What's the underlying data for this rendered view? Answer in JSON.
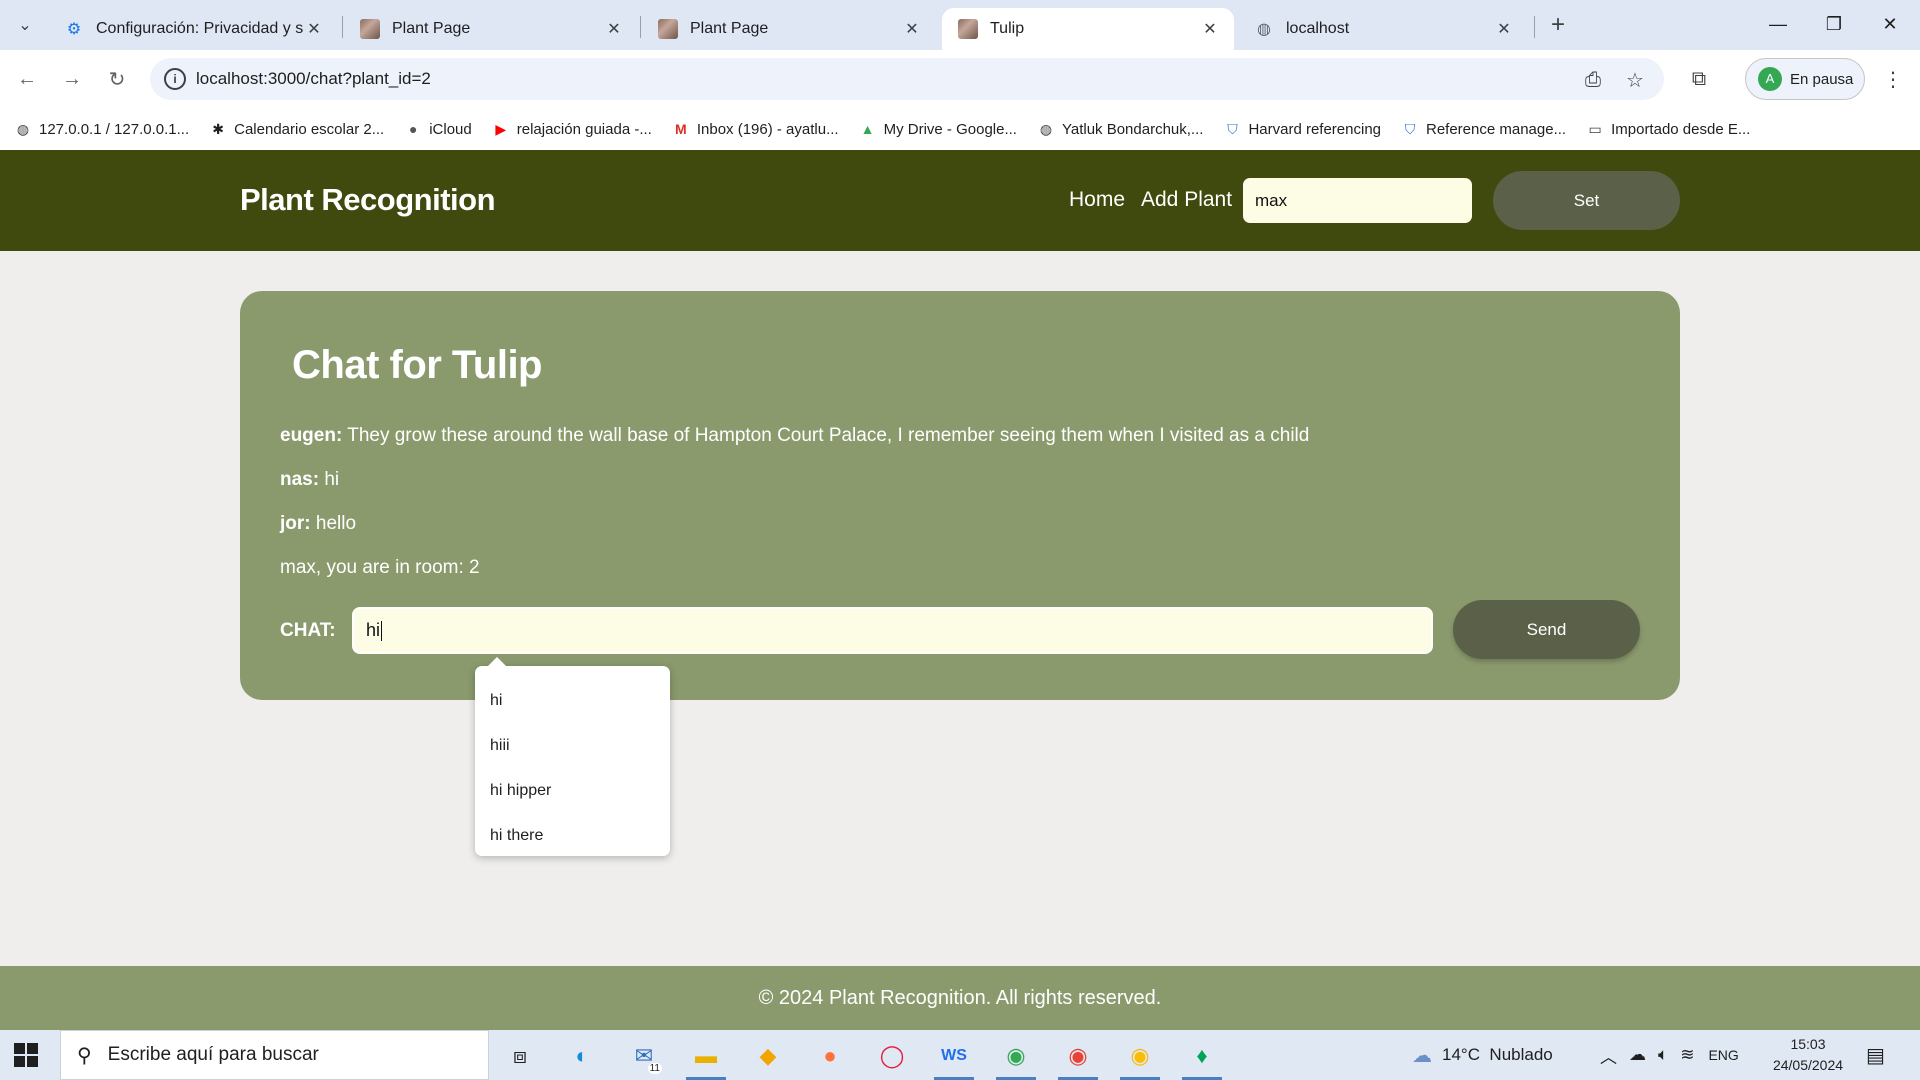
{
  "browser": {
    "tabs": [
      {
        "title": "Configuración: Privacidad y seg",
        "icon": "gear-icon"
      },
      {
        "title": "Plant Page",
        "icon": "plant-image-icon"
      },
      {
        "title": "Plant Page",
        "icon": "plant-image-icon"
      },
      {
        "title": "Tulip",
        "icon": "plant-image-icon",
        "active": true
      },
      {
        "title": "localhost",
        "icon": "globe-icon"
      }
    ],
    "url": "localhost:3000/chat?plant_id=2",
    "profile_initial": "A",
    "profile_status": "En pausa",
    "bookmarks": [
      {
        "label": "127.0.0.1 / 127.0.0.1...",
        "icon": "globe-icon"
      },
      {
        "label": "Calendario escolar 2...",
        "icon": "calendar-logo-icon"
      },
      {
        "label": "iCloud",
        "icon": "apple-icon"
      },
      {
        "label": "relajación guiada -...",
        "icon": "youtube-icon"
      },
      {
        "label": "Inbox (196) - ayatlu...",
        "icon": "gmail-icon"
      },
      {
        "label": "My Drive - Google...",
        "icon": "google-drive-icon"
      },
      {
        "label": "Yatluk Bondarchuk,...",
        "icon": "globe-icon"
      },
      {
        "label": "Harvard referencing",
        "icon": "shield-icon"
      },
      {
        "label": "Reference manage...",
        "icon": "shield-icon"
      },
      {
        "label": "Importado desde E...",
        "icon": "folder-icon"
      }
    ]
  },
  "header": {
    "brand": "Plant Recognition",
    "nav": [
      "Home",
      "Add Plant"
    ],
    "username_value": "max",
    "set_label": "Set"
  },
  "chat": {
    "title": "Chat for Tulip",
    "messages": [
      {
        "user": "eugen:",
        "text": " They grow these around the wall base of Hampton Court Palace, I remember seeing them when I visited as a child"
      },
      {
        "user": "nas:",
        "text": " hi"
      },
      {
        "user": "jor:",
        "text": " hello"
      }
    ],
    "room_notice": "max, you are in room: 2",
    "input_label": "CHAT:",
    "input_value": "hi",
    "send_label": "Send",
    "autocomplete": [
      "hi",
      "hiii",
      "hi hipper",
      "hi there"
    ]
  },
  "footer": {
    "text": "© 2024 Plant Recognition. All rights reserved."
  },
  "colors": {
    "header_bg": "#414a0e",
    "card_bg": "#8a9a6d",
    "button_bg": "#5b6048",
    "input_bg": "#fdfde6"
  },
  "taskbar": {
    "search_placeholder": "Escribe aquí para buscar",
    "mail_badge": "11",
    "weather": "14°C  Nublado",
    "language": "ENG",
    "time": "15:03",
    "date": "24/05/2024"
  }
}
